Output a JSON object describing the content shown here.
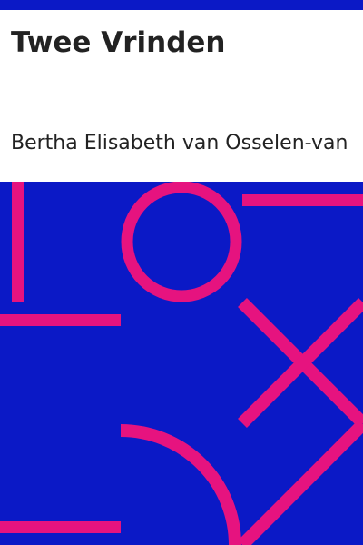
{
  "book": {
    "title": "Twee Vrinden",
    "author": "Bertha Elisabeth van Osselen-van"
  },
  "colors": {
    "top_bar": "#0b19c6",
    "artwork_background": "#0b19c6",
    "artwork_shapes": "#e6137f",
    "text": "#222222",
    "page": "#ffffff"
  }
}
